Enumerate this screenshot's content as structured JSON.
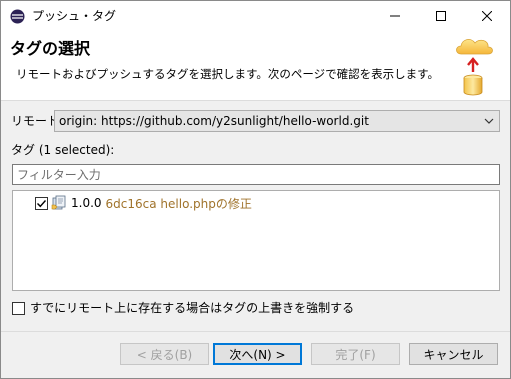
{
  "window": {
    "title": "プッシュ・タグ"
  },
  "banner": {
    "title": "タグの選択",
    "description": "リモートおよびプッシュするタグを選択します。次のページで確認を表示します。"
  },
  "remote": {
    "label": "リモート:",
    "value": "origin: https://github.com/y2sunlight/hello-world.git"
  },
  "tags": {
    "label": "タグ (1 selected):",
    "filter_placeholder": "フィルター入力",
    "items": [
      {
        "name": "1.0.0",
        "commit": "6dc16ca hello.phpの修正",
        "checked": true
      }
    ]
  },
  "force_option": {
    "label": "すでにリモート上に存在する場合はタグの上書きを強制する",
    "checked": false
  },
  "buttons": {
    "back": "< 戻る(B)",
    "next": "次へ(N) >",
    "finish": "完了(F)",
    "cancel": "キャンセル"
  },
  "colors": {
    "commit_text": "#a0732b",
    "default_button_border": "#0078d7"
  }
}
